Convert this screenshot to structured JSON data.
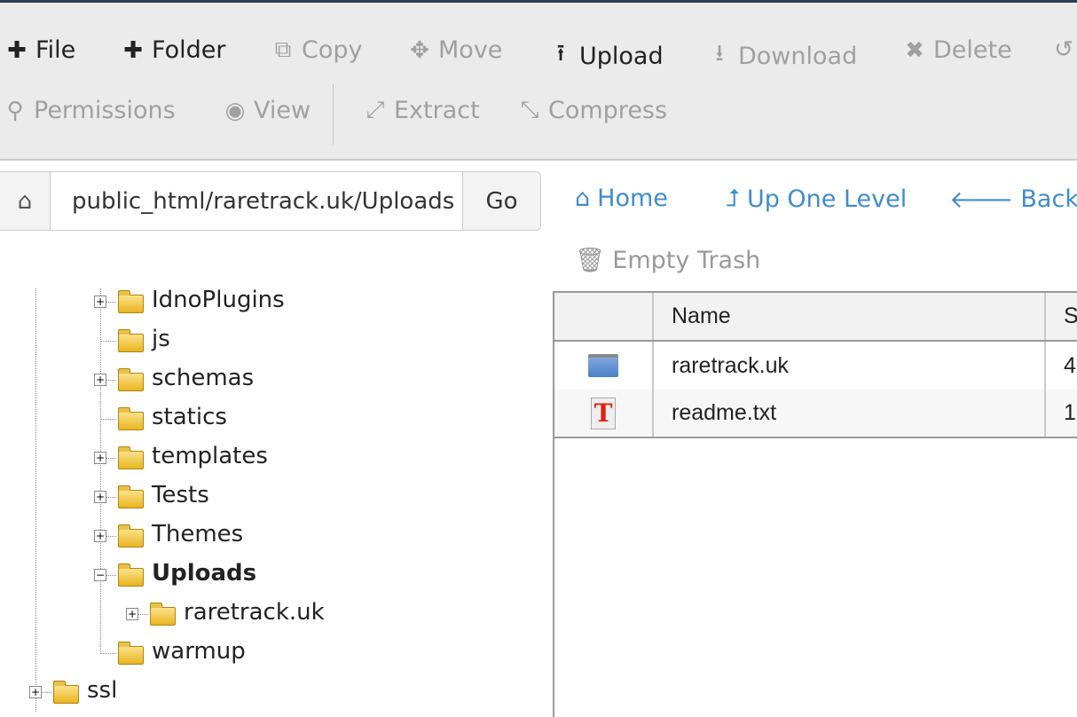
{
  "toolbar": {
    "row1": [
      {
        "label": "File",
        "icon": "plus-icon",
        "enabled": true
      },
      {
        "label": "Folder",
        "icon": "plus-icon",
        "enabled": true
      },
      {
        "label": "Copy",
        "icon": "copy-icon",
        "enabled": false
      },
      {
        "label": "Move",
        "icon": "move-icon",
        "enabled": false
      },
      {
        "label": "Upload",
        "icon": "upload-icon",
        "enabled": true
      },
      {
        "label": "Download",
        "icon": "download-icon",
        "enabled": false
      },
      {
        "label": "Delete",
        "icon": "x-icon",
        "enabled": false
      }
    ],
    "row2": [
      {
        "label": "Permissions",
        "icon": "key-icon"
      },
      {
        "label": "View",
        "icon": "eye-icon"
      },
      {
        "label": "Extract",
        "icon": "expand-icon"
      },
      {
        "label": "Compress",
        "icon": "compress-icon"
      }
    ]
  },
  "path": {
    "value": "public_html/raretrack.uk/Uploads",
    "go": "Go"
  },
  "nav": {
    "home": "Home",
    "up": "Up One Level",
    "back": "Back",
    "empty_trash": "Empty Trash"
  },
  "colors": {
    "link": "#428bca",
    "toolbar_bg": "#ebebeb"
  },
  "tree": [
    {
      "label": "IdnoPlugins",
      "level": 1,
      "expander": "+"
    },
    {
      "label": "js",
      "level": 1,
      "expander": ""
    },
    {
      "label": "schemas",
      "level": 1,
      "expander": "+"
    },
    {
      "label": "statics",
      "level": 1,
      "expander": ""
    },
    {
      "label": "templates",
      "level": 1,
      "expander": "+"
    },
    {
      "label": "Tests",
      "level": 1,
      "expander": "+"
    },
    {
      "label": "Themes",
      "level": 1,
      "expander": "+"
    },
    {
      "label": "Uploads",
      "level": 1,
      "expander": "-",
      "selected": true
    },
    {
      "label": "raretrack.uk",
      "level": 2,
      "expander": "+"
    },
    {
      "label": "warmup",
      "level": 1,
      "expander": ""
    },
    {
      "label": "ssl",
      "level": 0,
      "expander": "+"
    }
  ],
  "table": {
    "headers": [
      "",
      "Name",
      "S"
    ],
    "rows": [
      {
        "icon": "folder-icon",
        "name": "raretrack.uk",
        "size": "4"
      },
      {
        "icon": "text-file-icon",
        "name": "readme.txt",
        "size": "1"
      }
    ]
  }
}
